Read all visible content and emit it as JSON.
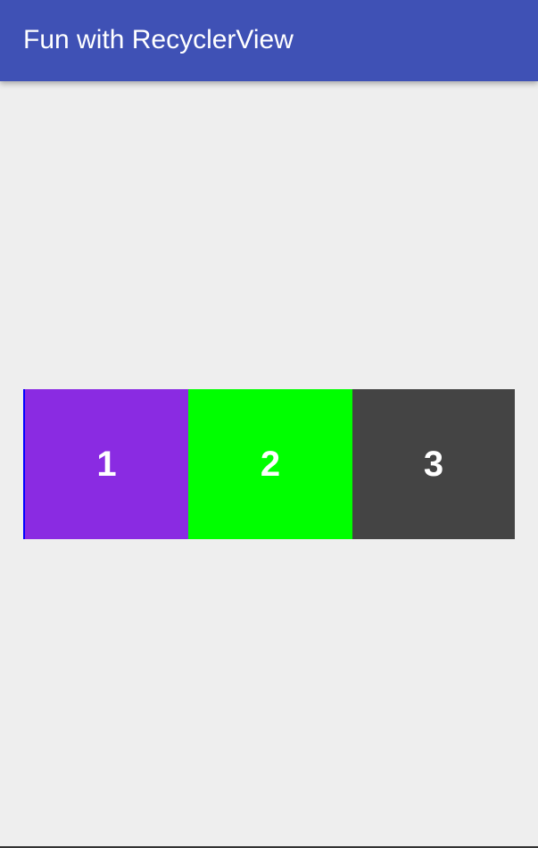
{
  "app_bar": {
    "title": "Fun with RecyclerView",
    "color": "#3f51b5"
  },
  "recycler": {
    "items": [
      {
        "label": "1",
        "color": "#8a2be2"
      },
      {
        "label": "2",
        "color": "#00ff00"
      },
      {
        "label": "3",
        "color": "#444444"
      }
    ]
  },
  "colors": {
    "background": "#eeeeee",
    "text_on_color": "#ffffff"
  }
}
